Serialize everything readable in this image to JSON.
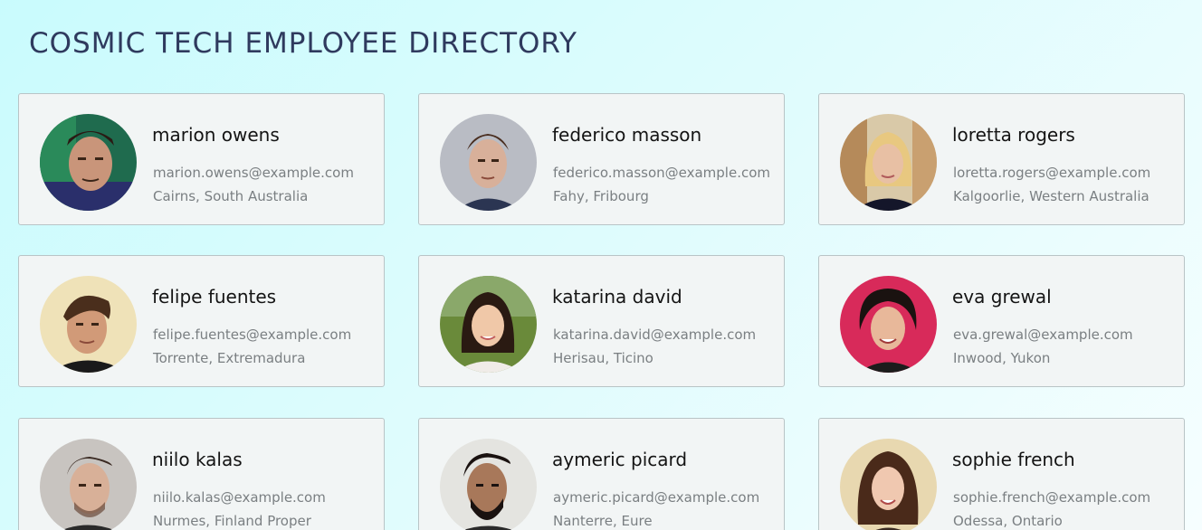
{
  "page": {
    "title": "COSMIC TECH EMPLOYEE DIRECTORY"
  },
  "employees": [
    {
      "name": "marion owens",
      "email": "marion.owens@example.com",
      "location": "Cairns, South Australia",
      "photo_icon": "avatar-photo"
    },
    {
      "name": "federico masson",
      "email": "federico.masson@example.com",
      "location": "Fahy, Fribourg",
      "photo_icon": "avatar-photo"
    },
    {
      "name": "loretta rogers",
      "email": "loretta.rogers@example.com",
      "location": "Kalgoorlie, Western Australia",
      "photo_icon": "avatar-photo"
    },
    {
      "name": "felipe fuentes",
      "email": "felipe.fuentes@example.com",
      "location": "Torrente, Extremadura",
      "photo_icon": "avatar-photo"
    },
    {
      "name": "katarina david",
      "email": "katarina.david@example.com",
      "location": "Herisau, Ticino",
      "photo_icon": "avatar-photo"
    },
    {
      "name": "eva grewal",
      "email": "eva.grewal@example.com",
      "location": "Inwood, Yukon",
      "photo_icon": "avatar-photo"
    },
    {
      "name": "niilo kalas",
      "email": "niilo.kalas@example.com",
      "location": "Nurmes, Finland Proper",
      "photo_icon": "avatar-photo"
    },
    {
      "name": "aymeric picard",
      "email": "aymeric.picard@example.com",
      "location": "Nanterre, Eure",
      "photo_icon": "avatar-photo"
    },
    {
      "name": "sophie french",
      "email": "sophie.french@example.com",
      "location": "Odessa, Ontario",
      "photo_icon": "avatar-photo"
    }
  ],
  "colors": {
    "title": "#2f3a5e",
    "card_bg": "#f2f5f5",
    "card_border": "#b9c4c6",
    "name": "#141414",
    "meta": "#7a7f82",
    "bg_start": "#c9fbfd",
    "bg_end": "#f6feff"
  }
}
